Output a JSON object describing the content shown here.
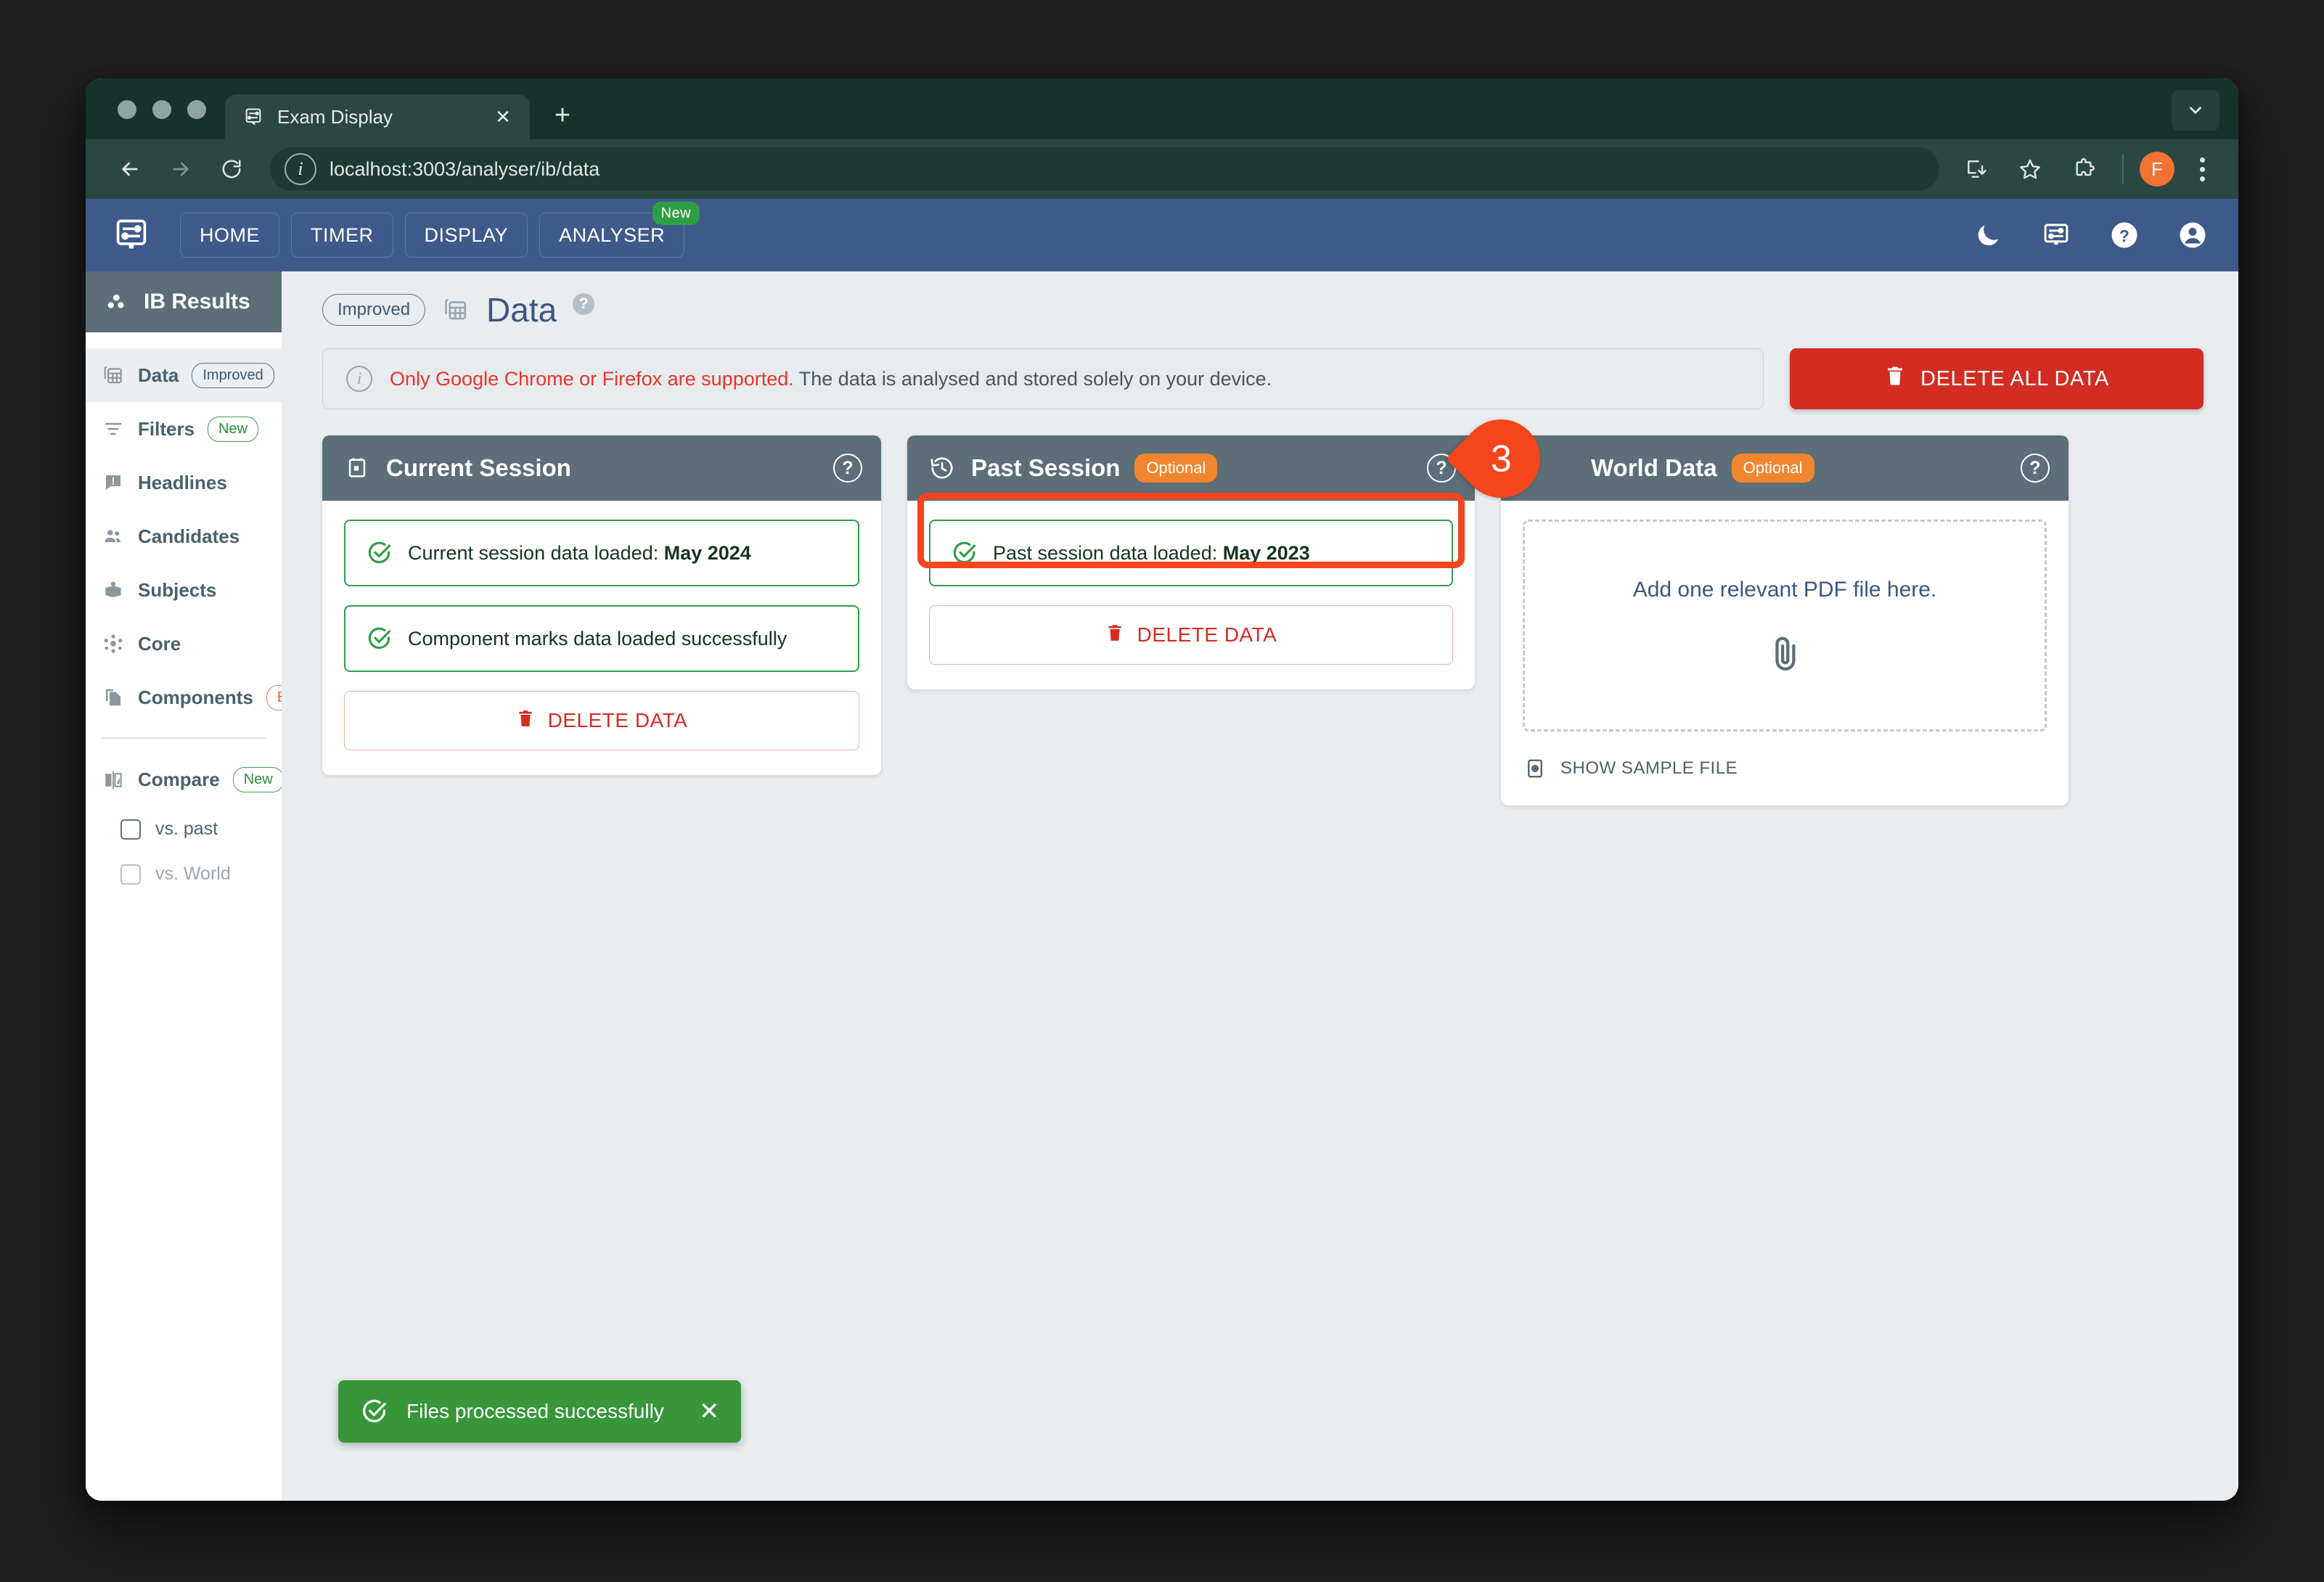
{
  "browser": {
    "tab": {
      "title": "Exam Display",
      "favicon_icon": "display-settings-icon",
      "close_icon": "close-icon"
    },
    "new_tab_icon": "plus-icon",
    "tab_list_icon": "chevron-down-icon",
    "back_icon": "arrow-left-icon",
    "forward_icon": "arrow-right-icon",
    "reload_icon": "reload-icon",
    "site_info_icon": "info-circle-icon",
    "url": "localhost:3003/analyser/ib/data",
    "install_icon": "install-app-icon",
    "bookmark_icon": "star-icon",
    "extensions_icon": "puzzle-piece-icon",
    "profile_initial": "F",
    "menu_icon": "kebab-menu-icon"
  },
  "navbar": {
    "brand_icon": "display-settings-icon",
    "items": [
      {
        "label": "HOME",
        "badge": null
      },
      {
        "label": "TIMER",
        "badge": null
      },
      {
        "label": "DISPLAY",
        "badge": null
      },
      {
        "label": "ANALYSER",
        "badge": "New"
      }
    ],
    "icons": [
      {
        "name": "dark-mode-icon"
      },
      {
        "name": "display-settings-icon"
      },
      {
        "name": "help-icon"
      },
      {
        "name": "account-icon"
      }
    ]
  },
  "sidebar": {
    "header": {
      "title": "IB Results",
      "icon": "bubble-chart-icon"
    },
    "items": [
      {
        "label": "Data",
        "badge": "Improved",
        "badge_style": "default",
        "icon": "data-table-icon",
        "active": true
      },
      {
        "label": "Filters",
        "badge": "New",
        "badge_style": "green",
        "icon": "filter-icon",
        "active": false
      },
      {
        "label": "Headlines",
        "badge": null,
        "badge_style": null,
        "icon": "announcement-icon",
        "active": false
      },
      {
        "label": "Candidates",
        "badge": null,
        "badge_style": null,
        "icon": "people-icon",
        "active": false
      },
      {
        "label": "Subjects",
        "badge": null,
        "badge_style": null,
        "icon": "book-icon",
        "active": false
      },
      {
        "label": "Core",
        "badge": null,
        "badge_style": null,
        "icon": "hub-icon",
        "active": false
      },
      {
        "label": "Components",
        "badge": "Beta",
        "badge_style": "orange",
        "icon": "documents-icon",
        "active": false
      }
    ],
    "compare": {
      "label": "Compare",
      "badge": "New",
      "icon": "compare-icon",
      "options": [
        {
          "label": "vs. past",
          "checked": false,
          "disabled": false
        },
        {
          "label": "vs. World",
          "checked": false,
          "disabled": true
        }
      ]
    }
  },
  "page": {
    "badge": "Improved",
    "title": "Data",
    "title_icon": "data-table-icon",
    "help_icon": "question-mark-icon",
    "info": {
      "icon": "info-circle-icon",
      "warning": "Only Google Chrome or Firefox are supported.",
      "rest": " The data is analysed and stored solely on your device."
    },
    "delete_all": {
      "label": "DELETE ALL DATA",
      "icon": "trash-icon"
    }
  },
  "cards": [
    {
      "title": "Current Session",
      "icon": "calendar-icon",
      "optional_badge": null,
      "help_icon": "question-mark-icon",
      "statuses": [
        {
          "prefix": "Current session data loaded: ",
          "strong": "May 2024",
          "icon": "check-circle-icon"
        },
        {
          "prefix": "Component marks data loaded successfully",
          "strong": "",
          "icon": "check-circle-icon"
        }
      ],
      "delete": {
        "label": "DELETE DATA",
        "icon": "trash-icon"
      }
    },
    {
      "title": "Past Session",
      "icon": "history-icon",
      "optional_badge": "Optional",
      "help_icon": "question-mark-icon",
      "statuses": [
        {
          "prefix": "Past session data loaded: ",
          "strong": "May 2023",
          "icon": "check-circle-icon"
        }
      ],
      "delete": {
        "label": "DELETE DATA",
        "icon": "trash-icon"
      }
    },
    {
      "title": "World Data",
      "icon": "public-icon",
      "optional_badge": "Optional",
      "help_icon": "question-mark-icon",
      "dropzone": {
        "text": "Add one relevant PDF file here.",
        "icon": "paperclip-icon"
      },
      "sample": {
        "label": "SHOW SAMPLE FILE",
        "icon": "preview-icon"
      }
    }
  ],
  "callout": {
    "number": "3"
  },
  "toast": {
    "message": "Files processed successfully",
    "icon": "check-circle-icon",
    "close_icon": "close-icon"
  },
  "colors": {
    "accent_blue": "#3e5a8a",
    "card_header": "#5c6e78",
    "danger_red": "#d32c22",
    "success_green": "#2e9e49",
    "highlight_orange": "#f4451d",
    "optional_orange": "#f2862f",
    "toast_green": "#37963a"
  }
}
